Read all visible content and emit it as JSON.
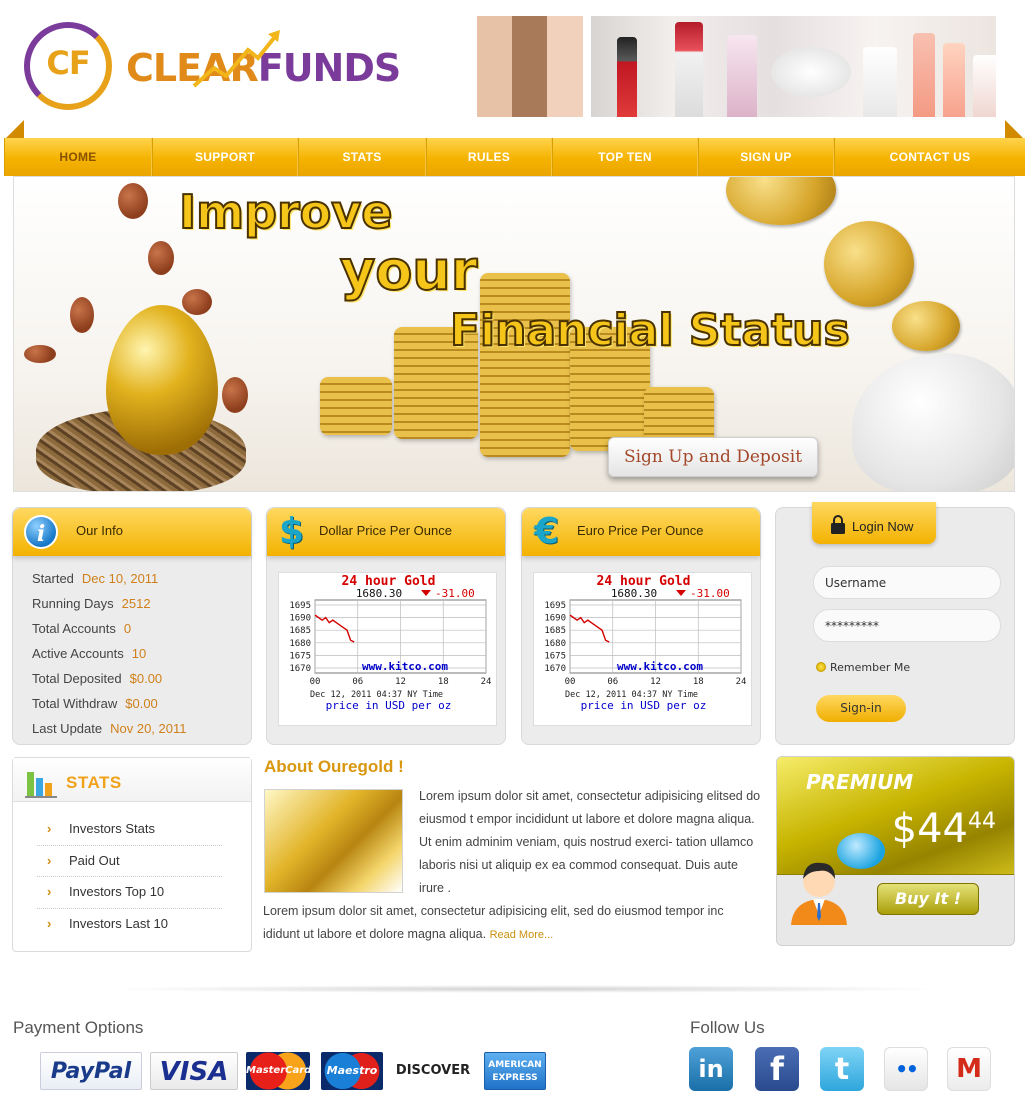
{
  "brand": {
    "logo_initials": "CF",
    "logo_word_1": "CLEAR",
    "logo_word_2": "FUNDS"
  },
  "nav": {
    "items": [
      {
        "label": "HOME",
        "active": true
      },
      {
        "label": "SUPPORT"
      },
      {
        "label": "STATS"
      },
      {
        "label": "RULES"
      },
      {
        "label": "TOP TEN"
      },
      {
        "label": "SIGN UP"
      },
      {
        "label": "CONTACT US"
      }
    ]
  },
  "banner": {
    "line1": "Improve",
    "line2": "your",
    "line3": "Financial Status",
    "cta": "Sign Up and Deposit"
  },
  "our_info": {
    "title": "Our Info",
    "icon": "info-icon",
    "rows": [
      {
        "label": "Started",
        "value": "Dec 10, 2011"
      },
      {
        "label": "Running Days",
        "value": "2512"
      },
      {
        "label": "Total Accounts",
        "value": "0"
      },
      {
        "label": "Active Accounts",
        "value": "10"
      },
      {
        "label": "Total Deposited",
        "value": "$0.00"
      },
      {
        "label": "Total Withdraw",
        "value": "$0.00"
      },
      {
        "label": "Last Update",
        "value": "Nov 20, 2011"
      }
    ]
  },
  "dollar_box": {
    "title": "Dollar Price Per Ounce",
    "icon_glyph": "$"
  },
  "euro_box": {
    "title": "Euro Price Per Ounce",
    "icon_glyph": "€"
  },
  "gold_chart": {
    "title": "24 hour Gold",
    "price": "1680.30",
    "change": "-31.00",
    "website": "www.kitco.com",
    "date_line": "Dec 12, 2011 04:37 NY Time",
    "footer": "price in USD per oz",
    "y_ticks": [
      "1695",
      "1690",
      "1685",
      "1680",
      "1675",
      "1670"
    ],
    "x_ticks": [
      "00",
      "06",
      "12",
      "18",
      "24"
    ]
  },
  "chart_data": {
    "type": "line",
    "title": "24 hour Gold",
    "xlabel": "",
    "ylabel": "",
    "x": [
      0,
      0.5,
      1,
      1.5,
      2,
      2.5,
      3,
      3.5,
      4,
      4.5,
      5,
      5.5
    ],
    "series": [
      {
        "values": [
          1691,
          1690,
          1689,
          1690,
          1688,
          1689,
          1688,
          1687,
          1686,
          1685,
          1681,
          1680.3
        ]
      }
    ],
    "xlim": [
      0,
      24
    ],
    "ylim": [
      1668,
      1697
    ],
    "grid": true,
    "colors": {
      "line": "#d40000",
      "title": "#d40000",
      "site": "#0000cc"
    }
  },
  "login": {
    "title": "Login Now",
    "username_value": "Username",
    "password_value": "*********",
    "remember_label": "Remember Me",
    "submit_label": "Sign-in"
  },
  "stats": {
    "title": "STATS",
    "items": [
      "Investors Stats",
      "Paid Out",
      "Investors Top 10",
      "Investors Last 10"
    ]
  },
  "about": {
    "title": "About Ouregold !",
    "p1": "Lorem ipsum dolor sit amet, consectetur  adipisicing elitsed do eiusmod t empor  incididunt  ut  labore  et dolore magna aliqua. Ut enim  adminim veniam, quis nostrud exerci- tation ullamco laboris nisi ut aliquip ex  ea commod consequat. Duis aute irure .",
    "p2": "Lorem ipsum dolor sit amet, consectetur adipisicing elit, sed do eiusmod tempor inc ididunt ut labore et dolore magna aliqua.",
    "read_more": "Read More..."
  },
  "premium": {
    "label": "PREMIUM",
    "price_main": "$44",
    "price_cents": "44",
    "buy_label": "Buy It !"
  },
  "footer": {
    "payment_title": "Payment Options",
    "payments": [
      "PayPal",
      "VISA",
      "MasterCard",
      "Maestro",
      "DISCOVER",
      "AMERICAN EXPRESS"
    ],
    "follow_title": "Follow Us",
    "social": [
      {
        "icon": "linkedin-icon",
        "glyph": "in"
      },
      {
        "icon": "facebook-icon",
        "glyph": "f"
      },
      {
        "icon": "twitter-icon",
        "glyph": "t"
      },
      {
        "icon": "flickr-icon",
        "glyph": "••"
      },
      {
        "icon": "gmail-icon",
        "glyph": "M"
      }
    ]
  },
  "colors": {
    "accent": "#f5b300",
    "accent_text": "#d0801a",
    "brand_purple": "#7b3b9a"
  }
}
